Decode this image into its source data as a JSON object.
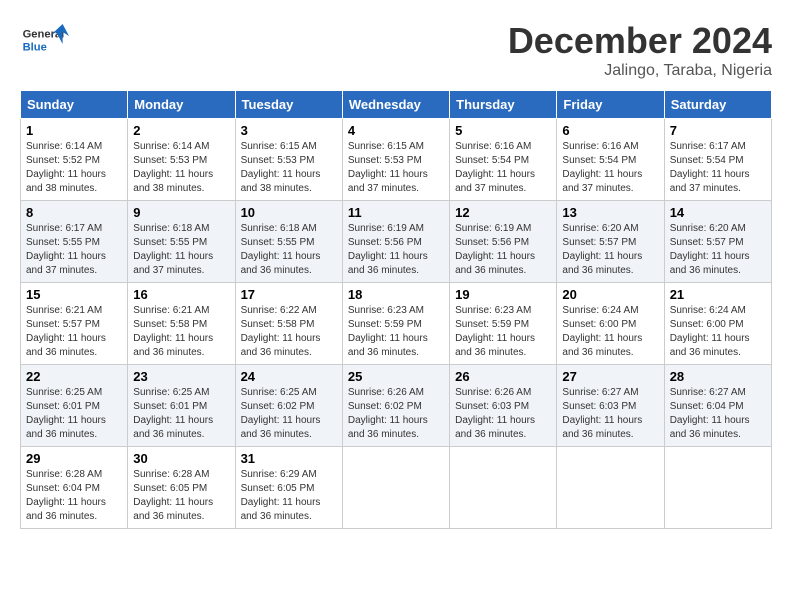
{
  "header": {
    "logo_general": "General",
    "logo_blue": "Blue",
    "month_title": "December 2024",
    "location": "Jalingo, Taraba, Nigeria"
  },
  "weekdays": [
    "Sunday",
    "Monday",
    "Tuesday",
    "Wednesday",
    "Thursday",
    "Friday",
    "Saturday"
  ],
  "weeks": [
    [
      {
        "day": "1",
        "sunrise": "6:14 AM",
        "sunset": "5:52 PM",
        "daylight": "11 hours and 38 minutes."
      },
      {
        "day": "2",
        "sunrise": "6:14 AM",
        "sunset": "5:53 PM",
        "daylight": "11 hours and 38 minutes."
      },
      {
        "day": "3",
        "sunrise": "6:15 AM",
        "sunset": "5:53 PM",
        "daylight": "11 hours and 38 minutes."
      },
      {
        "day": "4",
        "sunrise": "6:15 AM",
        "sunset": "5:53 PM",
        "daylight": "11 hours and 37 minutes."
      },
      {
        "day": "5",
        "sunrise": "6:16 AM",
        "sunset": "5:54 PM",
        "daylight": "11 hours and 37 minutes."
      },
      {
        "day": "6",
        "sunrise": "6:16 AM",
        "sunset": "5:54 PM",
        "daylight": "11 hours and 37 minutes."
      },
      {
        "day": "7",
        "sunrise": "6:17 AM",
        "sunset": "5:54 PM",
        "daylight": "11 hours and 37 minutes."
      }
    ],
    [
      {
        "day": "8",
        "sunrise": "6:17 AM",
        "sunset": "5:55 PM",
        "daylight": "11 hours and 37 minutes."
      },
      {
        "day": "9",
        "sunrise": "6:18 AM",
        "sunset": "5:55 PM",
        "daylight": "11 hours and 37 minutes."
      },
      {
        "day": "10",
        "sunrise": "6:18 AM",
        "sunset": "5:55 PM",
        "daylight": "11 hours and 36 minutes."
      },
      {
        "day": "11",
        "sunrise": "6:19 AM",
        "sunset": "5:56 PM",
        "daylight": "11 hours and 36 minutes."
      },
      {
        "day": "12",
        "sunrise": "6:19 AM",
        "sunset": "5:56 PM",
        "daylight": "11 hours and 36 minutes."
      },
      {
        "day": "13",
        "sunrise": "6:20 AM",
        "sunset": "5:57 PM",
        "daylight": "11 hours and 36 minutes."
      },
      {
        "day": "14",
        "sunrise": "6:20 AM",
        "sunset": "5:57 PM",
        "daylight": "11 hours and 36 minutes."
      }
    ],
    [
      {
        "day": "15",
        "sunrise": "6:21 AM",
        "sunset": "5:57 PM",
        "daylight": "11 hours and 36 minutes."
      },
      {
        "day": "16",
        "sunrise": "6:21 AM",
        "sunset": "5:58 PM",
        "daylight": "11 hours and 36 minutes."
      },
      {
        "day": "17",
        "sunrise": "6:22 AM",
        "sunset": "5:58 PM",
        "daylight": "11 hours and 36 minutes."
      },
      {
        "day": "18",
        "sunrise": "6:23 AM",
        "sunset": "5:59 PM",
        "daylight": "11 hours and 36 minutes."
      },
      {
        "day": "19",
        "sunrise": "6:23 AM",
        "sunset": "5:59 PM",
        "daylight": "11 hours and 36 minutes."
      },
      {
        "day": "20",
        "sunrise": "6:24 AM",
        "sunset": "6:00 PM",
        "daylight": "11 hours and 36 minutes."
      },
      {
        "day": "21",
        "sunrise": "6:24 AM",
        "sunset": "6:00 PM",
        "daylight": "11 hours and 36 minutes."
      }
    ],
    [
      {
        "day": "22",
        "sunrise": "6:25 AM",
        "sunset": "6:01 PM",
        "daylight": "11 hours and 36 minutes."
      },
      {
        "day": "23",
        "sunrise": "6:25 AM",
        "sunset": "6:01 PM",
        "daylight": "11 hours and 36 minutes."
      },
      {
        "day": "24",
        "sunrise": "6:25 AM",
        "sunset": "6:02 PM",
        "daylight": "11 hours and 36 minutes."
      },
      {
        "day": "25",
        "sunrise": "6:26 AM",
        "sunset": "6:02 PM",
        "daylight": "11 hours and 36 minutes."
      },
      {
        "day": "26",
        "sunrise": "6:26 AM",
        "sunset": "6:03 PM",
        "daylight": "11 hours and 36 minutes."
      },
      {
        "day": "27",
        "sunrise": "6:27 AM",
        "sunset": "6:03 PM",
        "daylight": "11 hours and 36 minutes."
      },
      {
        "day": "28",
        "sunrise": "6:27 AM",
        "sunset": "6:04 PM",
        "daylight": "11 hours and 36 minutes."
      }
    ],
    [
      {
        "day": "29",
        "sunrise": "6:28 AM",
        "sunset": "6:04 PM",
        "daylight": "11 hours and 36 minutes."
      },
      {
        "day": "30",
        "sunrise": "6:28 AM",
        "sunset": "6:05 PM",
        "daylight": "11 hours and 36 minutes."
      },
      {
        "day": "31",
        "sunrise": "6:29 AM",
        "sunset": "6:05 PM",
        "daylight": "11 hours and 36 minutes."
      },
      null,
      null,
      null,
      null
    ]
  ]
}
